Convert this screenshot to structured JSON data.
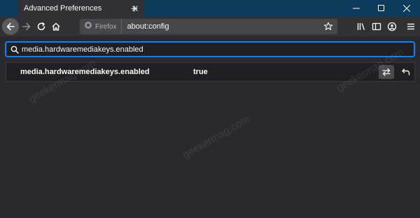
{
  "tab": {
    "title": "Advanced Preferences"
  },
  "urlbar": {
    "identity_label": "Firefox",
    "url": "about:config"
  },
  "search": {
    "value": "media.hardwaremediakeys.enabled"
  },
  "preferences": [
    {
      "name": "media.hardwaremediakeys.enabled",
      "value": "true"
    }
  ],
  "watermark": {
    "text": "geekermag.com"
  },
  "colors": {
    "accent": "#0a84ff",
    "tabstrip": "#0c3b5e",
    "toolbar": "#323234",
    "page": "#2a2a2e"
  },
  "icons": [
    "minimize-icon",
    "maximize-icon",
    "close-icon",
    "back-icon",
    "forward-icon",
    "reload-icon",
    "home-icon",
    "firefox-icon",
    "bookmark-star-icon",
    "library-icon",
    "sidebar-icon",
    "account-icon",
    "menu-icon",
    "search-icon",
    "toggle-icon",
    "reset-icon",
    "tab-close-icon",
    "new-tab-icon"
  ]
}
